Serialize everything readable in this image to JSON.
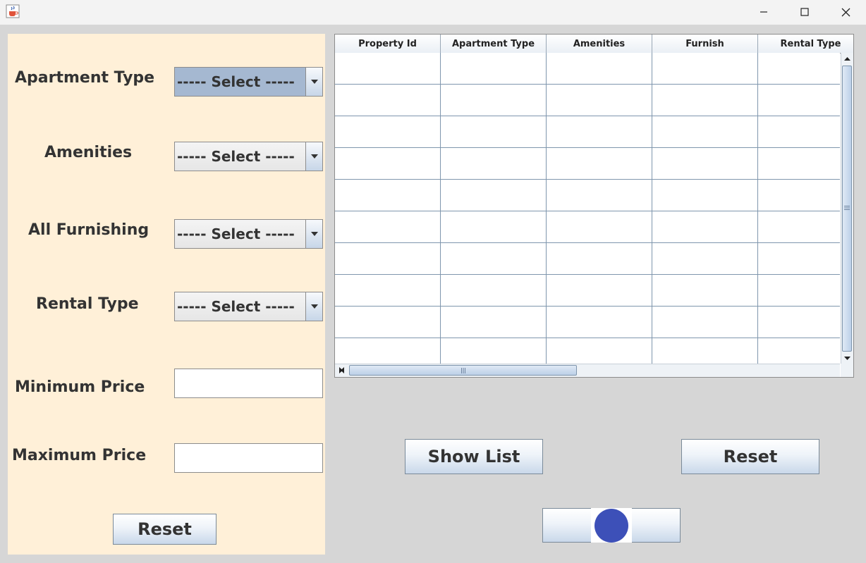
{
  "window": {
    "app_icon": "java-cup-icon",
    "controls": [
      "minimize-icon",
      "maximize-icon",
      "close-icon"
    ]
  },
  "filters": {
    "apartment_type": {
      "label": "Apartment Type",
      "value": "----- Select -----"
    },
    "amenities": {
      "label": "Amenities",
      "value": "----- Select -----"
    },
    "furnishing": {
      "label": "All Furnishing",
      "value": "----- Select -----"
    },
    "rental_type": {
      "label": "Rental Type",
      "value": "----- Select -----"
    },
    "min_price": {
      "label": "Minimum Price",
      "value": ""
    },
    "max_price": {
      "label": "Maximum Price",
      "value": ""
    },
    "reset_label": "Reset"
  },
  "table": {
    "columns": [
      "Property Id",
      "Apartment Type",
      "Amenities",
      "Furnish",
      "Rental Type"
    ],
    "visible_rows": 10
  },
  "actions": {
    "show_list_label": "Show List",
    "reset_label": "Reset",
    "toggle_icon": "blue-circle-icon"
  },
  "colors": {
    "panel_bg": "#fff0d8",
    "window_bg": "#d6d6d6",
    "focused_combo": "#a5b8d1",
    "toggle_circle": "#3d50b8"
  }
}
